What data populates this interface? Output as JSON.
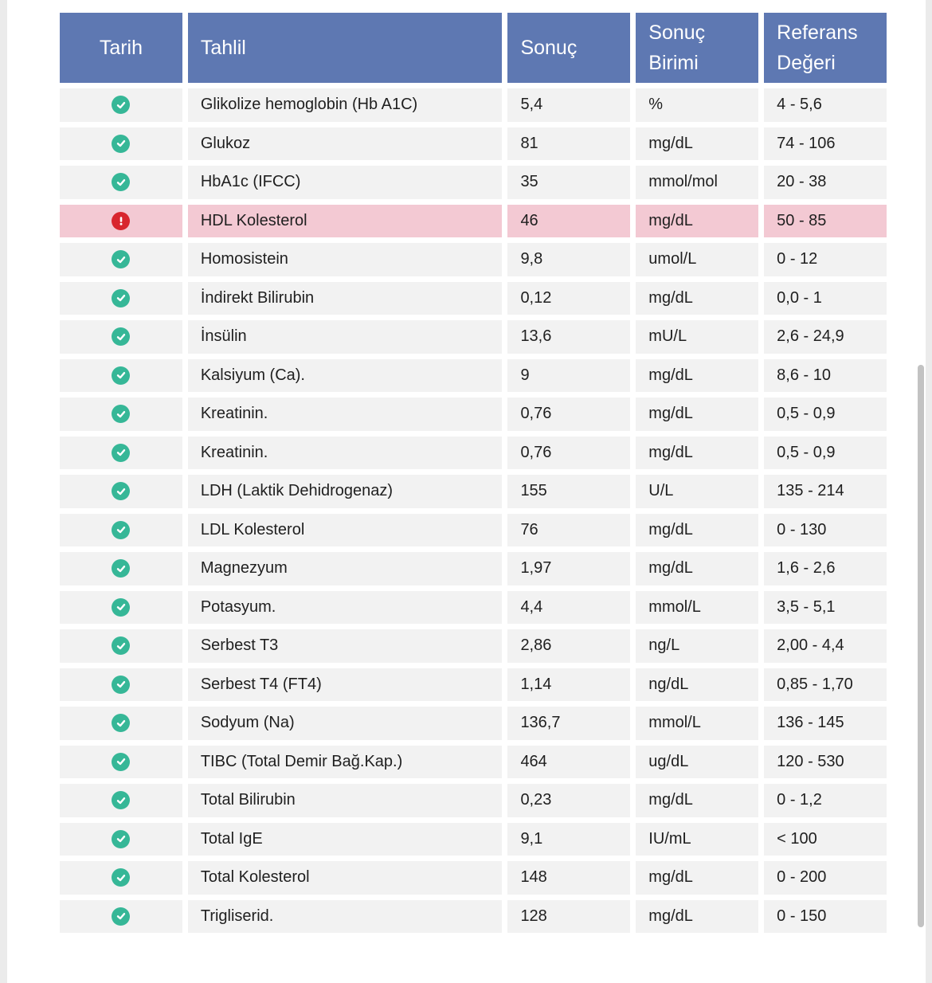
{
  "table": {
    "headers": {
      "date": "Tarih",
      "test": "Tahlil",
      "result": "Sonuç",
      "unit": "Sonuç Birimi",
      "reference": "Referans Değeri"
    },
    "rows": [
      {
        "status": "normal",
        "test": "Glikolize hemoglobin (Hb A1C)",
        "result": "5,4",
        "unit": "%",
        "reference": "4 - 5,6"
      },
      {
        "status": "normal",
        "test": "Glukoz",
        "result": "81",
        "unit": "mg/dL",
        "reference": "74 - 106"
      },
      {
        "status": "normal",
        "test": "HbA1c (IFCC)",
        "result": "35",
        "unit": "mmol/mol",
        "reference": "20 - 38"
      },
      {
        "status": "abnormal",
        "test": "HDL Kolesterol",
        "result": "46",
        "unit": "mg/dL",
        "reference": "50 - 85"
      },
      {
        "status": "normal",
        "test": "Homosistein",
        "result": "9,8",
        "unit": "umol/L",
        "reference": "0 - 12"
      },
      {
        "status": "normal",
        "test": "İndirekt Bilirubin",
        "result": "0,12",
        "unit": "mg/dL",
        "reference": "0,0 - 1"
      },
      {
        "status": "normal",
        "test": "İnsülin",
        "result": "13,6",
        "unit": "mU/L",
        "reference": "2,6 - 24,9"
      },
      {
        "status": "normal",
        "test": "Kalsiyum (Ca).",
        "result": "9",
        "unit": "mg/dL",
        "reference": "8,6 - 10"
      },
      {
        "status": "normal",
        "test": "Kreatinin.",
        "result": "0,76",
        "unit": "mg/dL",
        "reference": "0,5 - 0,9"
      },
      {
        "status": "normal",
        "test": "Kreatinin.",
        "result": "0,76",
        "unit": "mg/dL",
        "reference": "0,5 - 0,9"
      },
      {
        "status": "normal",
        "test": "LDH (Laktik Dehidrogenaz)",
        "result": "155",
        "unit": "U/L",
        "reference": "135 - 214"
      },
      {
        "status": "normal",
        "test": "LDL Kolesterol",
        "result": "76",
        "unit": "mg/dL",
        "reference": "0 - 130"
      },
      {
        "status": "normal",
        "test": "Magnezyum",
        "result": "1,97",
        "unit": "mg/dL",
        "reference": "1,6 - 2,6"
      },
      {
        "status": "normal",
        "test": "Potasyum.",
        "result": "4,4",
        "unit": "mmol/L",
        "reference": "3,5 - 5,1"
      },
      {
        "status": "normal",
        "test": "Serbest  T3",
        "result": "2,86",
        "unit": "ng/L",
        "reference": "2,00 - 4,4"
      },
      {
        "status": "normal",
        "test": "Serbest T4 (FT4)",
        "result": "1,14",
        "unit": "ng/dL",
        "reference": "0,85 - 1,70"
      },
      {
        "status": "normal",
        "test": "Sodyum (Na)",
        "result": "136,7",
        "unit": "mmol/L",
        "reference": "136 - 145"
      },
      {
        "status": "normal",
        "test": "TIBC (Total Demir Bağ.Kap.)",
        "result": "464",
        "unit": "ug/dL",
        "reference": "120 - 530"
      },
      {
        "status": "normal",
        "test": "Total Bilirubin",
        "result": "0,23",
        "unit": "mg/dL",
        "reference": "0 - 1,2"
      },
      {
        "status": "normal",
        "test": "Total IgE",
        "result": "9,1",
        "unit": "IU/mL",
        "reference": "< 100"
      },
      {
        "status": "normal",
        "test": "Total Kolesterol",
        "result": "148",
        "unit": "mg/dL",
        "reference": "0 - 200"
      },
      {
        "status": "normal",
        "test": "Trigliserid.",
        "result": "128",
        "unit": "mg/dL",
        "reference": "0 - 150"
      }
    ]
  },
  "icons": {
    "normal": "check-circle-icon",
    "abnormal": "exclamation-circle-icon"
  },
  "colors": {
    "header_bg": "#5e78b2",
    "row_bg": "#f2f2f2",
    "alert_row_bg": "#f3c9d3",
    "ok_icon": "#36b797",
    "alert_icon": "#d8262e"
  }
}
